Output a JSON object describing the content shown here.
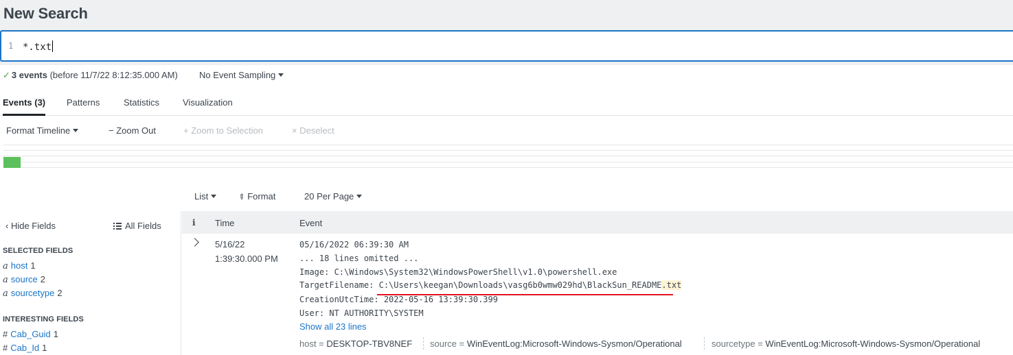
{
  "title": "New Search",
  "search": {
    "line_number": "1",
    "query": "*.txt"
  },
  "status": {
    "check": "✓",
    "events": "3 events",
    "before": "(before 11/7/22 8:12:35.000 AM)",
    "sampling": "No Event Sampling"
  },
  "tabs": [
    {
      "label": "Events (3)",
      "active": true
    },
    {
      "label": "Patterns"
    },
    {
      "label": "Statistics"
    },
    {
      "label": "Visualization"
    }
  ],
  "timeline_toolbar": {
    "format_timeline": "Format Timeline",
    "zoom_out": "− Zoom Out",
    "zoom_to_selection": "+ Zoom to Selection",
    "deselect": "× Deselect"
  },
  "timeline": {
    "bar_color": "#5cc05c"
  },
  "results_toolbar": {
    "list": "List",
    "format": "Format",
    "per_page": "20 Per Page"
  },
  "sidebar": {
    "hide_fields": "Hide Fields",
    "all_fields": "All Fields",
    "selected_heading": "SELECTED FIELDS",
    "selected": [
      {
        "type": "a",
        "name": "host",
        "count": "1"
      },
      {
        "type": "a",
        "name": "source",
        "count": "2"
      },
      {
        "type": "a",
        "name": "sourcetype",
        "count": "2"
      }
    ],
    "interesting_heading": "INTERESTING FIELDS",
    "interesting": [
      {
        "type": "#",
        "name": "Cab_Guid",
        "count": "1"
      },
      {
        "type": "#",
        "name": "Cab_Id",
        "count": "1"
      }
    ]
  },
  "table": {
    "headers": {
      "info": "i",
      "time": "Time",
      "event": "Event"
    },
    "row": {
      "date": "5/16/22",
      "time": "1:39:30.000 PM",
      "lines": [
        "05/16/2022 06:39:30 AM",
        "... 18 lines omitted ...",
        "Image: C:\\Windows\\System32\\WindowsPowerShell\\v1.0\\powershell.exe",
        "TargetFilename: C:\\Users\\keegan\\Downloads\\vasg6b0wmw029hd\\BlackSun_README",
        ".txt",
        "CreationUtcTime: 2022-05-16 13:39:30.399",
        "User: NT AUTHORITY\\SYSTEM"
      ],
      "show_all": "Show all 23 lines",
      "meta": [
        {
          "key": "host =",
          "value": "DESKTOP-TBV8NEF"
        },
        {
          "key": "source =",
          "value": "WinEventLog:Microsoft-Windows-Sysmon/Operational"
        },
        {
          "key": "sourcetype =",
          "value": "WinEventLog:Microsoft-Windows-Sysmon/Operational"
        }
      ]
    }
  },
  "colors": {
    "accent": "#1a75c8",
    "annotation_underline": "#e0141e",
    "highlight": "#fdf3d5",
    "success": "#53a051"
  }
}
